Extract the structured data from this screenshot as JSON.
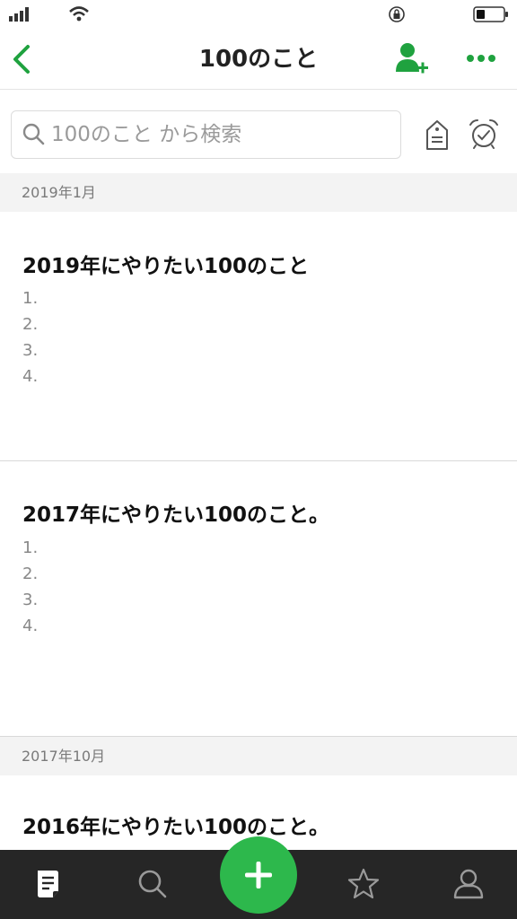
{
  "colors": {
    "accent": "#1fa23f",
    "fab": "#2db84c",
    "tabbar": "#262626"
  },
  "status_bar": {
    "icons": [
      "signal-icon",
      "wifi-icon",
      "orientation-lock-icon",
      "battery-icon"
    ]
  },
  "nav": {
    "title": "100のこと",
    "icons": [
      "chevron-left-icon",
      "add-person-icon",
      "more-dots-icon"
    ]
  },
  "search": {
    "placeholder": "100のこと から検索",
    "value": "",
    "icons": [
      "search-icon",
      "tag-icon",
      "alarm-clock-icon"
    ]
  },
  "sections": [
    {
      "header": "2019年1月",
      "notes": [
        {
          "title": "2019年にやりたい100のこと",
          "lines": [
            "1.",
            "2.",
            "3.",
            "4."
          ]
        },
        {
          "title": "2017年にやりたい100のこと。",
          "lines": [
            "1.",
            "2.",
            "3.",
            "4."
          ]
        }
      ]
    },
    {
      "header": "2017年10月",
      "notes": [
        {
          "title": "2016年にやりたい100のこと。",
          "lines": []
        }
      ]
    }
  ],
  "tab_bar": {
    "items": [
      "notes-icon",
      "search-icon",
      "add-icon",
      "star-icon",
      "person-icon"
    ],
    "selected": "notes-icon"
  }
}
